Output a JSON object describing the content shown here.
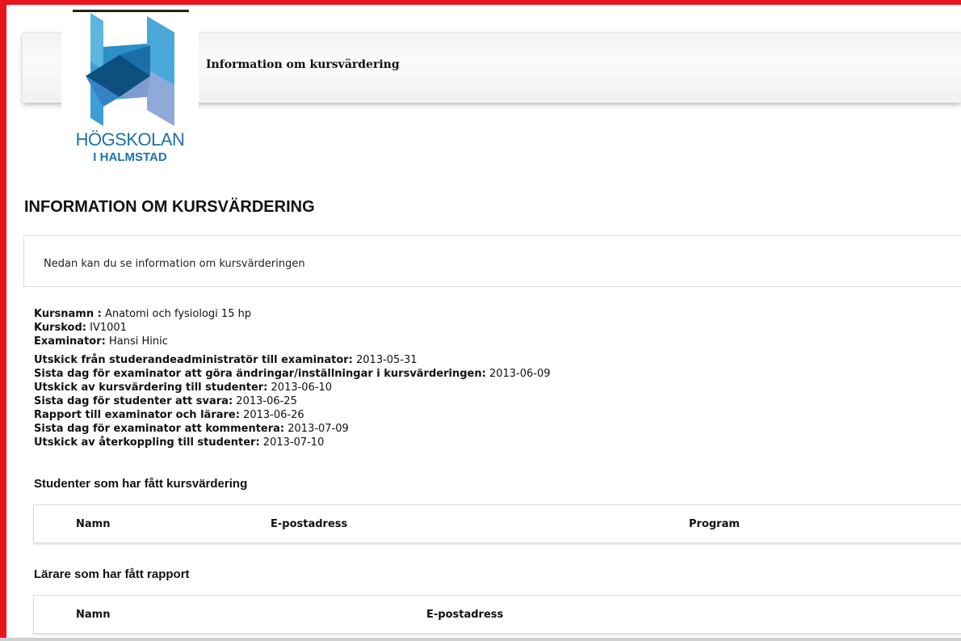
{
  "header": {
    "title": "Information om kursvärdering"
  },
  "logo": {
    "line1": "HÖGSKOLAN",
    "line2": "I HALMSTAD"
  },
  "page": {
    "heading": "INFORMATION OM KURSVÄRDERING",
    "intro": "Nedan kan du se information om kursvärderingen"
  },
  "course": {
    "name_label": "Kursnamn :",
    "name_value": "Anatomi och fysiologi 15 hp",
    "code_label": "Kurskod:",
    "code_value": "IV1001",
    "examiner_label": "Examinator:",
    "examiner_value": "Hansi Hinic"
  },
  "dates": [
    {
      "label": "Utskick från studerandeadministratör till examinator:",
      "value": "2013-05-31"
    },
    {
      "label": "Sista dag för examinator att göra ändringar/inställningar i kursvärderingen:",
      "value": "2013-06-09"
    },
    {
      "label": "Utskick av kursvärdering till studenter:",
      "value": "2013-06-10"
    },
    {
      "label": "Sista dag för studenter att svara:",
      "value": "2013-06-25"
    },
    {
      "label": "Rapport till examinator och lärare:",
      "value": "2013-06-26"
    },
    {
      "label": "Sista dag för examinator att kommentera:",
      "value": "2013-07-09"
    },
    {
      "label": "Utskick av återkoppling till studenter:",
      "value": "2013-07-10"
    }
  ],
  "students_section": {
    "title": "Studenter som har fått kursvärdering",
    "columns": [
      "Namn",
      "E-postadress",
      "Program"
    ]
  },
  "teachers_section": {
    "title": "Lärare som har fått rapport",
    "columns": [
      "Namn",
      "E-postadress"
    ]
  },
  "colors": {
    "frame": "#e8161b",
    "logo_blue": "#1e73a8"
  }
}
